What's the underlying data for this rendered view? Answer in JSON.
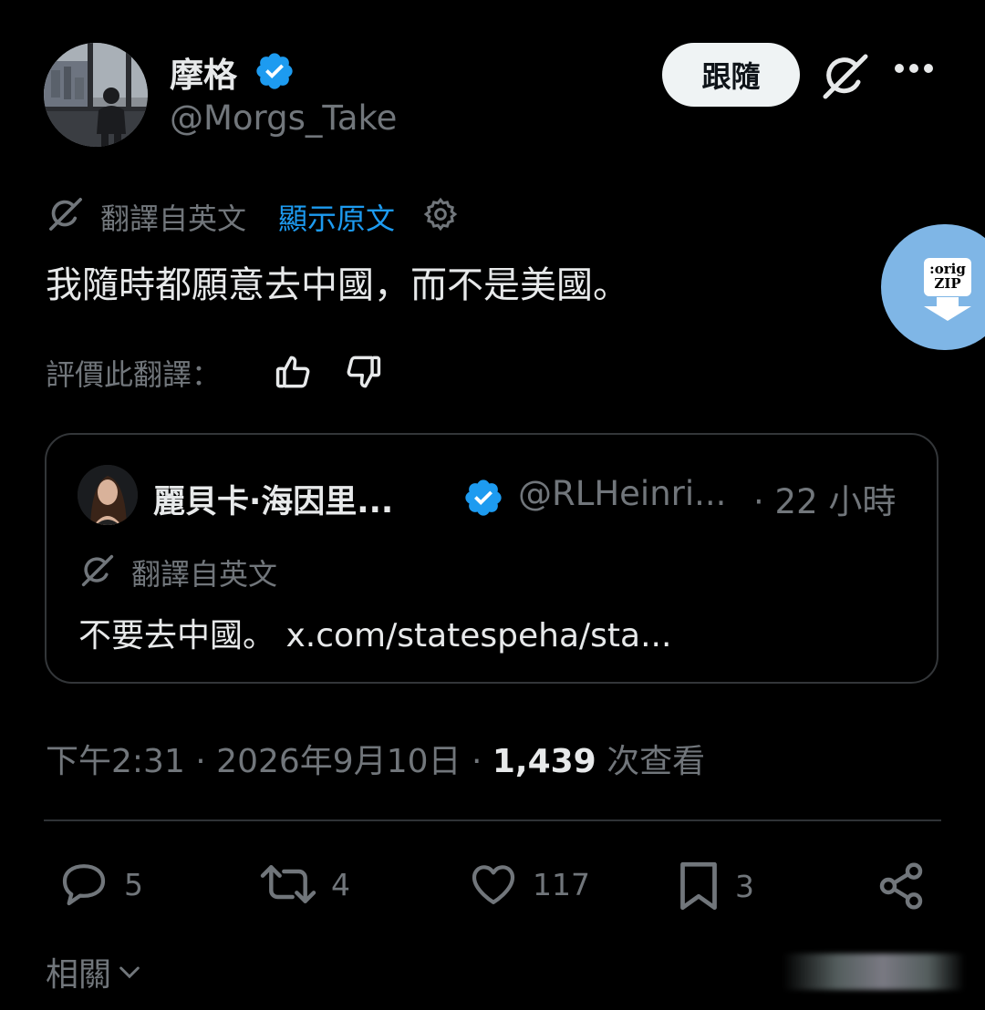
{
  "author": {
    "display_name": "摩格",
    "handle": "@Morgs_Take",
    "verified": true
  },
  "header": {
    "follow_label": "跟隨"
  },
  "translation": {
    "translated_label": "翻譯自英文",
    "show_original": "顯示原文"
  },
  "tweet": {
    "text": "我隨時都願意去中國，而不是美國。",
    "rate_label": "評價此翻譯："
  },
  "widget": {
    "line1": ":orig",
    "line2": "ZIP"
  },
  "quote": {
    "display_name": "麗貝卡·海因里...",
    "handle": "@RLHeinri...",
    "time": "· 22 小時",
    "translated_label": "翻譯自英文",
    "text": "不要去中國。 x.com/statespeha/sta..."
  },
  "meta": {
    "time": "下午2:31 · 2026年9月10日 ·",
    "views_count": "1,439",
    "views_label": "次查看"
  },
  "actions": {
    "replies": "5",
    "retweets": "4",
    "likes": "117",
    "bookmarks": "3"
  },
  "related_label": "相關",
  "colors": {
    "background": "#000000",
    "text": "#e7e9ea",
    "muted": "#71767b",
    "accent": "#1d9bf0",
    "verified": "#1d9bf0",
    "widget": "#7fb6e6"
  },
  "icons": [
    "verified-badge-icon",
    "grok-icon",
    "more-icon",
    "translate-icon",
    "settings-icon",
    "thumbs-up-icon",
    "thumbs-down-icon",
    "reply-icon",
    "retweet-icon",
    "like-icon",
    "bookmark-icon",
    "share-icon",
    "chevron-down-icon"
  ]
}
